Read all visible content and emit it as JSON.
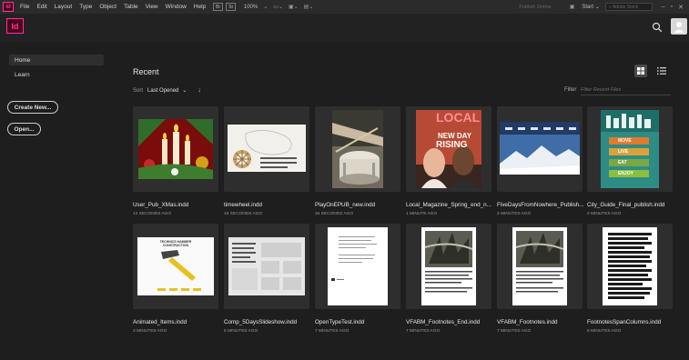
{
  "menubar": {
    "logo": "Id",
    "items": [
      "File",
      "Edit",
      "Layout",
      "Type",
      "Object",
      "Table",
      "View",
      "Window",
      "Help"
    ],
    "br_label": "Br",
    "st_label": "St",
    "zoom": "100%",
    "publish_online": "Publish Online",
    "workspace": "Start",
    "stock_placeholder": "Adobe Stock"
  },
  "app": {
    "logo": "Id",
    "accent": "#ff3399",
    "logo_bg": "#49021f"
  },
  "sidebar": {
    "nav": [
      {
        "label": "Home"
      },
      {
        "label": "Learn"
      }
    ],
    "create_label": "Create New...",
    "open_label": "Open..."
  },
  "main": {
    "title": "Recent",
    "sort_label": "Sort",
    "sort_value": "Last Opened",
    "filter_label": "Filter",
    "filter_placeholder": "Filter Recent Files"
  },
  "files": [
    {
      "name": "User_Pub_XMas.indd",
      "time": "12 SECONDS AGO"
    },
    {
      "name": "timewheel.indd",
      "time": "16 SECONDS AGO"
    },
    {
      "name": "PlayOnEPUB_new.indd",
      "time": "34 SECONDS AGO"
    },
    {
      "name": "Local_Magazine_Spring_end_n...",
      "time": "1 MINUTE AGO"
    },
    {
      "name": "FiveDaysFromNowhere_Publish...",
      "time": "2 MINUTES AGO"
    },
    {
      "name": "City_Guide_Final_publish.indd",
      "time": "2 MINUTES AGO"
    },
    {
      "name": "Animated_Items.indd",
      "time": "3 MINUTES AGO"
    },
    {
      "name": "Comp_5DaysSlideshow.indd",
      "time": "5 MINUTES AGO"
    },
    {
      "name": "OpenTypeTest.indd",
      "time": "7 MINUTES AGO"
    },
    {
      "name": "VFABM_Footnotes_End.indd",
      "time": "7 MINUTES AGO"
    },
    {
      "name": "VFABM_Footnotes.indd",
      "time": "7 MINUTES AGO"
    },
    {
      "name": "FootnotesSpanColumns.indd",
      "time": "8 MINUTES AGO"
    }
  ],
  "thumb_text": {
    "magazine_title": "LOCAL",
    "magazine_sub": "NEW DAY",
    "magazine_word": "RISING",
    "city_buttons": [
      "MOVE",
      "LIVE",
      "EAT",
      "ENJOY"
    ],
    "animated_title": "TECHNICS HAMMER CONSTRUCTION"
  }
}
